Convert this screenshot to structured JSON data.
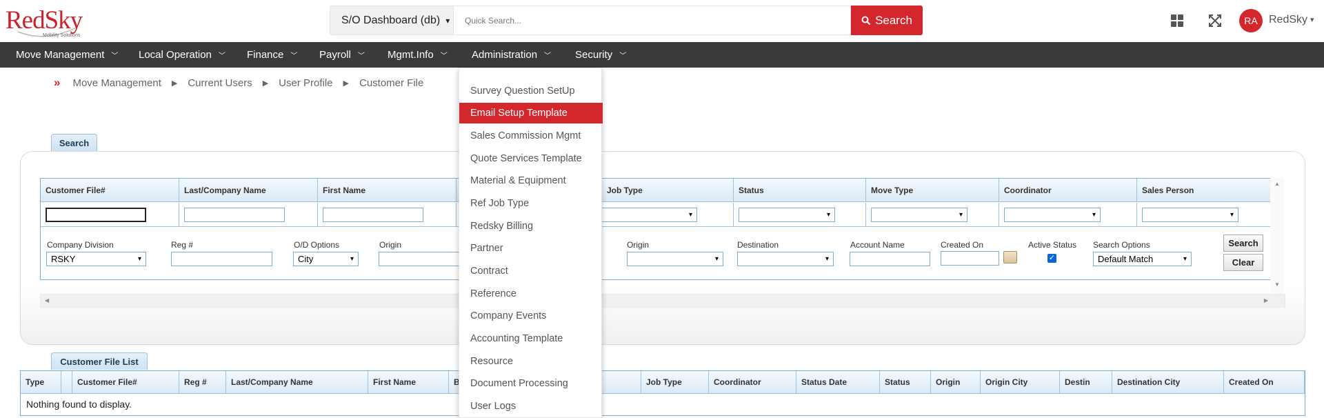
{
  "brand": {
    "logo_text": "RedSky",
    "logo_subtext": "Mobility Solutions"
  },
  "header": {
    "db_select": "S/O Dashboard (db)",
    "search_placeholder": "Quick Search...",
    "search_button": "Search",
    "user_initials": "RA",
    "user_name": "RedSky"
  },
  "nav": {
    "items": [
      {
        "label": "Move Management"
      },
      {
        "label": "Local Operation"
      },
      {
        "label": "Finance"
      },
      {
        "label": "Payroll"
      },
      {
        "label": "Mgmt.Info"
      },
      {
        "label": "Administration"
      },
      {
        "label": "Security"
      }
    ]
  },
  "breadcrumb": [
    "Move Management",
    "Current Users",
    "User Profile",
    "Customer File"
  ],
  "search_tab": "Search",
  "search_grid": {
    "headers": [
      "Customer File#",
      "Last/Company Name",
      "First Name",
      "",
      "Job Type",
      "Status",
      "Move Type",
      "Coordinator",
      "Sales Person"
    ],
    "row2": {
      "company_division_label": "Company Division",
      "company_division_value": "RSKY",
      "reg_label": "Reg #",
      "od_options_label": "O/D Options",
      "od_options_value": "City",
      "origin_label": "Origin",
      "origin2_label": "Origin",
      "destination_label": "Destination",
      "account_name_label": "Account Name",
      "created_on_label": "Created On",
      "active_status_label": "Active Status",
      "search_options_label": "Search Options",
      "search_options_value": "Default Match",
      "search_btn": "Search",
      "clear_btn": "Clear"
    }
  },
  "list_tab": "Customer File List",
  "list": {
    "headers": [
      "Type",
      "",
      "Customer File#",
      "Reg #",
      "Last/Company Name",
      "First Name",
      "B",
      "",
      "Job Type",
      "Coordinator",
      "Status Date",
      "Status",
      "Origin",
      "Origin City",
      "Destin",
      "Destination City",
      "Created On"
    ],
    "empty_message": "Nothing found to display."
  },
  "dropdown": {
    "items": [
      "Survey Question SetUp",
      "Email Setup Template",
      "Sales Commission Mgmt",
      "Quote Services Template",
      "Material & Equipment",
      "Ref Job Type",
      "Redsky Billing",
      "Partner",
      "Contract",
      "Reference",
      "Company Events",
      "Accounting Template",
      "Resource",
      "Document Processing",
      "User Logs"
    ],
    "active_index": 1
  },
  "colors": {
    "brand_red": "#d3262d",
    "nav_bg": "#3a3a3a",
    "grid_border": "#7aaed6"
  }
}
